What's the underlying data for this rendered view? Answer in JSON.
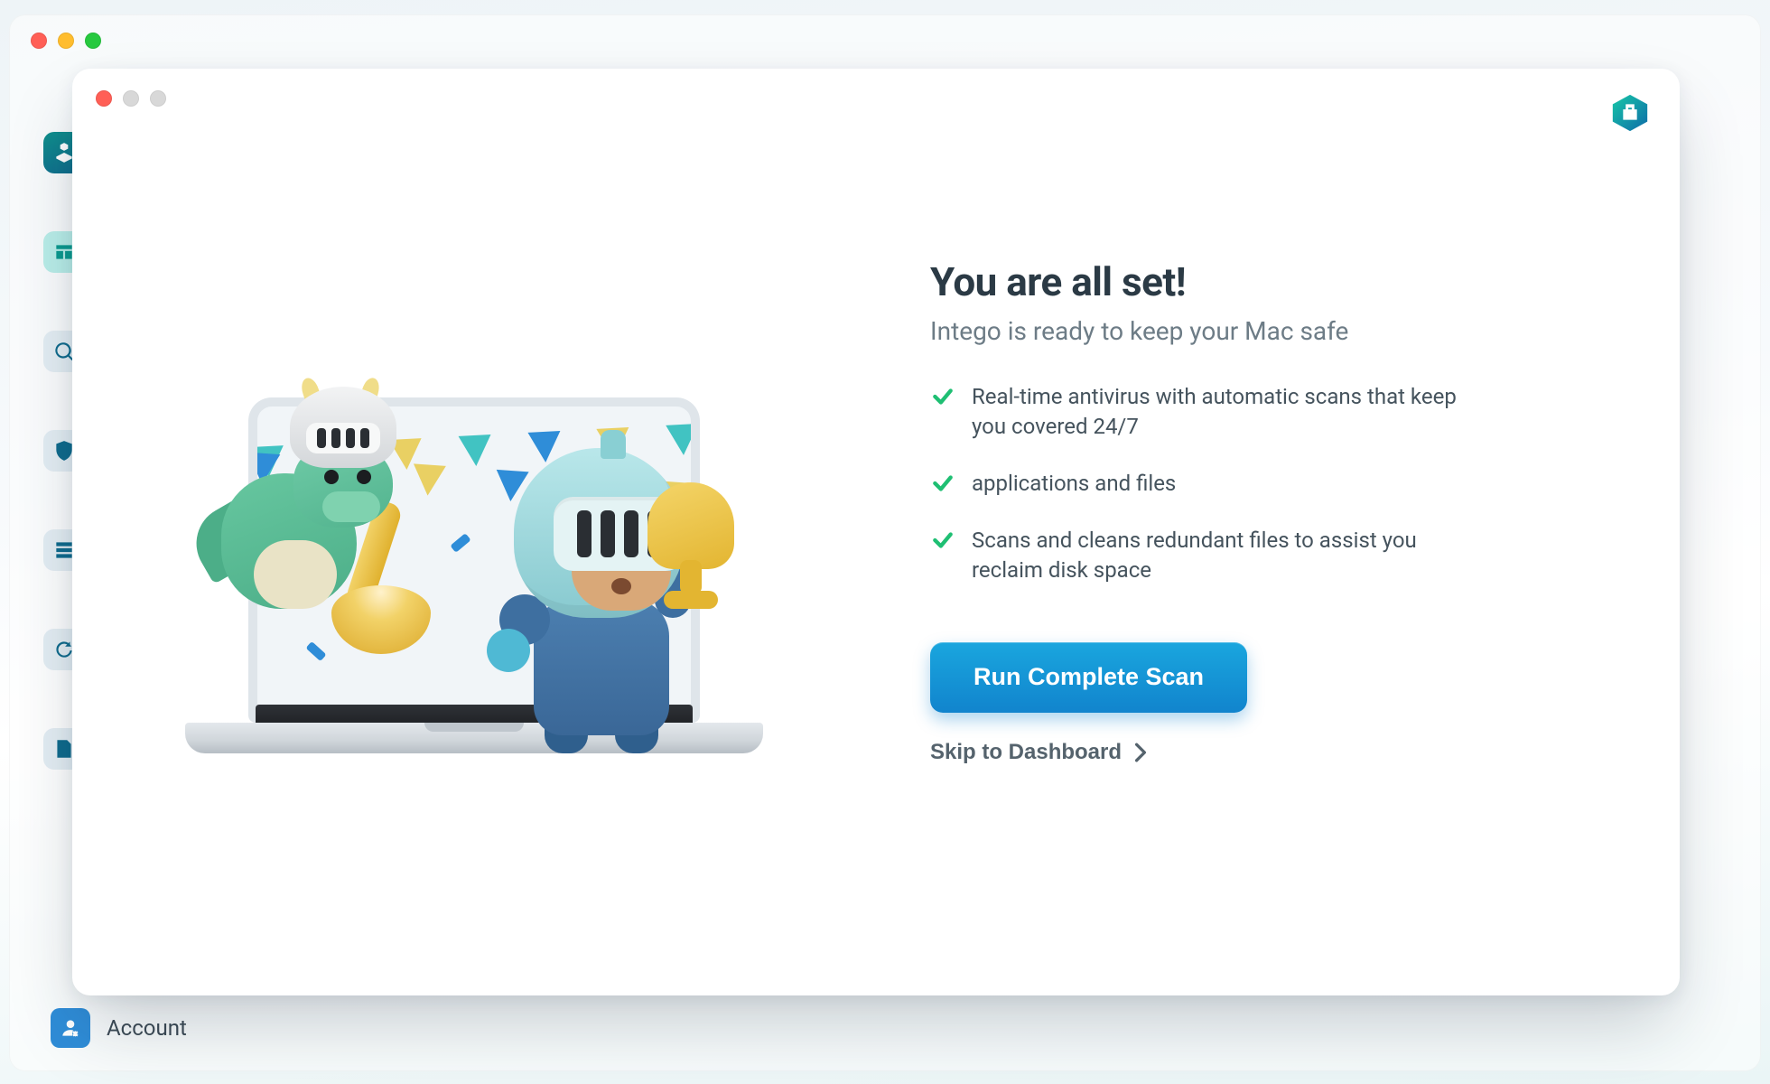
{
  "parent": {
    "sidebar_bottom_label": "Account"
  },
  "modal": {
    "title": "You are all set!",
    "subtitle": "Intego is ready to keep your Mac safe",
    "features": [
      "Real-time antivirus with automatic scans that keep you covered 24/7",
      "applications and files",
      "Scans and cleans redundant files to assist you reclaim disk space"
    ],
    "cta_label": "Run Complete Scan",
    "skip_label": "Skip to Dashboard"
  },
  "colors": {
    "accent_check": "#1fbf73",
    "cta_top": "#1aa6de",
    "cta_bottom": "#1184cd"
  }
}
